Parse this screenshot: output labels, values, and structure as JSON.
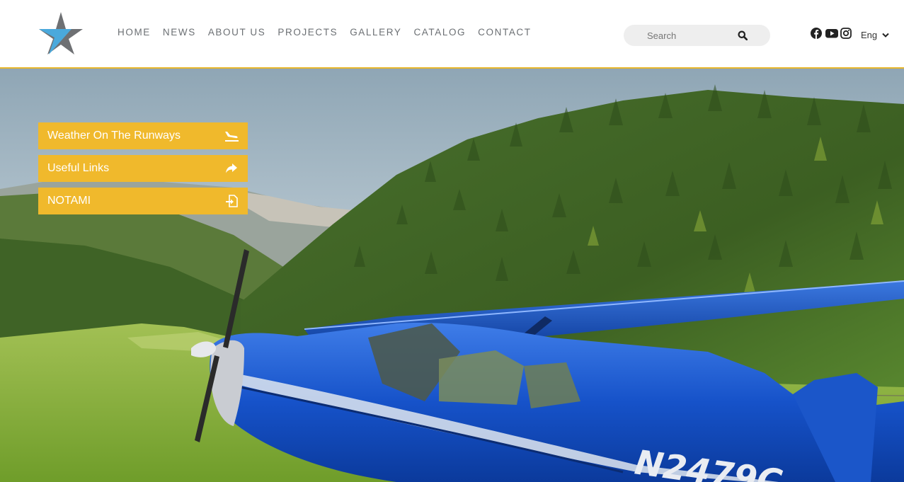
{
  "nav": {
    "items": [
      {
        "label": "HOME"
      },
      {
        "label": "NEWS"
      },
      {
        "label": "ABOUT US"
      },
      {
        "label": "PROJECTS"
      },
      {
        "label": "GALLERY"
      },
      {
        "label": "CATALOG"
      },
      {
        "label": "CONTACT"
      }
    ]
  },
  "search": {
    "placeholder": "Search",
    "icon": "search-icon"
  },
  "social": {
    "icons": [
      "facebook-icon",
      "youtube-icon",
      "instagram-icon"
    ]
  },
  "language": {
    "current": "Eng"
  },
  "side_menu": {
    "items": [
      {
        "label": "Weather On The Runways",
        "icon": "airplane-landing-icon"
      },
      {
        "label": "Useful Links",
        "icon": "share-arrow-icon"
      },
      {
        "label": "NOTAMI",
        "icon": "file-import-icon"
      }
    ]
  },
  "hero": {
    "tail_number": "N2479C"
  },
  "colors": {
    "accent": "#f0b92c",
    "header_border": "#e8b62a",
    "nav_text": "#6b6f73",
    "logo_blue": "#4aa9dc",
    "logo_gray": "#6e7073"
  }
}
